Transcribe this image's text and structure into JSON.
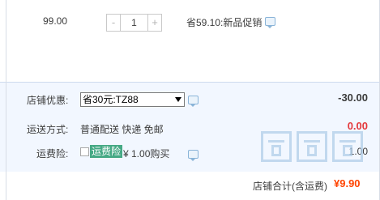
{
  "item": {
    "price": "99.00",
    "quantity": "1",
    "minus_label": "-",
    "plus_label": "+",
    "promo_text": "省59.10:新品促销"
  },
  "panel": {
    "discount": {
      "label": "店铺优惠:",
      "selected": "省30元:TZ88",
      "amount": "-30.00"
    },
    "shipping": {
      "label": "运送方式:",
      "method": "普通配送 快递 免邮",
      "amount": "0.00"
    },
    "insurance": {
      "label": "运费险:",
      "tag": "运费险",
      "price": "¥ 1.00购买",
      "amount": "1.00"
    }
  },
  "summary": {
    "label": "店铺合计(含运费)",
    "total": "¥9.90"
  },
  "colors": {
    "panel_bg": "#f2f7ff",
    "red": "#e4393c",
    "total_orange": "#ff4400",
    "insure_green": "#46a985"
  },
  "icons": [
    "comment-icon",
    "dropdown-arrow-icon",
    "checkbox-icon",
    "watermark-logo"
  ]
}
